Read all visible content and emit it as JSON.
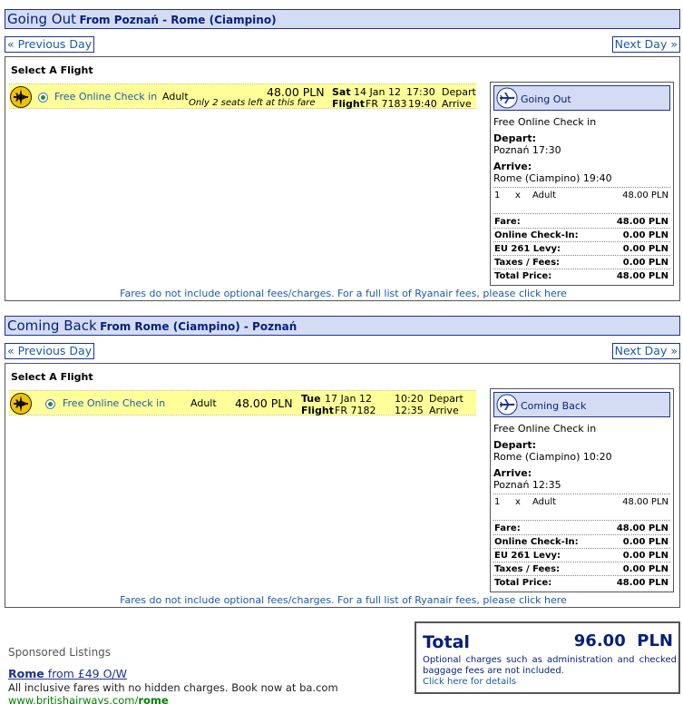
{
  "outbound": {
    "heading": "Going Out",
    "route": "From Poznań - Rome (Ciampino)",
    "prev_label": "« Previous Day",
    "next_label": "Next Day »",
    "select_title": "Select A Flight",
    "flight": {
      "checkin": "Free Online Check in",
      "pax_type": "Adult",
      "price": "48.00 PLN",
      "seats_note": "Only 2 seats left at this fare",
      "day": "Sat",
      "date": "14 Jan 12",
      "flight_label": "Flight",
      "flight_no": "FR 7183",
      "depart_time": "17:30",
      "depart_label": "Depart",
      "arrive_time": "19:40",
      "arrive_label": "Arrive"
    },
    "summary": {
      "title": "Going Out",
      "checkin": "Free Online Check in",
      "depart_label": "Depart:",
      "depart_value": "Poznań 17:30",
      "arrive_label": "Arrive:",
      "arrive_value": "Rome (Ciampino) 19:40",
      "pax_count": "1",
      "pax_x": "x",
      "pax_type": "Adult",
      "pax_price": "48.00 PLN",
      "rows": [
        {
          "label": "Fare:",
          "value": "48.00 PLN"
        },
        {
          "label": "Online Check-In:",
          "value": "0.00 PLN"
        },
        {
          "label": "EU 261 Levy:",
          "value": "0.00 PLN"
        },
        {
          "label": "Taxes / Fees:",
          "value": "0.00 PLN"
        },
        {
          "label": "Total Price:",
          "value": "48.00 PLN"
        }
      ]
    },
    "fare_note": "Fares do not include optional fees/charges. For a full list of Ryanair fees, please click here"
  },
  "return": {
    "heading": "Coming Back",
    "route": "From Rome (Ciampino) - Poznań",
    "prev_label": "« Previous Day",
    "next_label": "Next Day »",
    "select_title": "Select A Flight",
    "flight": {
      "checkin": "Free Online Check in",
      "pax_type": "Adult",
      "price": "48.00 PLN",
      "day": "Tue",
      "date": "17 Jan 12",
      "flight_label": "Flight",
      "flight_no": "FR 7182",
      "depart_time": "10:20",
      "depart_label": "Depart",
      "arrive_time": "12:35",
      "arrive_label": "Arrive"
    },
    "summary": {
      "title": "Coming Back",
      "checkin": "Free Online Check in",
      "depart_label": "Depart:",
      "depart_value": "Rome (Ciampino) 10:20",
      "arrive_label": "Arrive:",
      "arrive_value": "Poznań 12:35",
      "pax_count": "1",
      "pax_x": "x",
      "pax_type": "Adult",
      "pax_price": "48.00 PLN",
      "rows": [
        {
          "label": "Fare:",
          "value": "48.00 PLN"
        },
        {
          "label": "Online Check-In:",
          "value": "0.00 PLN"
        },
        {
          "label": "EU 261 Levy:",
          "value": "0.00 PLN"
        },
        {
          "label": "Taxes / Fees:",
          "value": "0.00 PLN"
        },
        {
          "label": "Total Price:",
          "value": "48.00 PLN"
        }
      ]
    },
    "fare_note": "Fares do not include optional fees/charges. For a full list of Ryanair fees, please click here"
  },
  "sponsored": {
    "heading": "Sponsored Listings",
    "ad_title_bold": "Rome",
    "ad_title_rest": "from £49 O/W",
    "ad_desc": "All inclusive fares with no hidden charges. Book now at ba.com",
    "ad_url_pre": "www.britishairways.com/",
    "ad_url_bold": "rome"
  },
  "total": {
    "label": "Total",
    "value": "96.00",
    "currency": "PLN",
    "note": "Optional charges such as administration and checked baggage fees are not included.",
    "link": "Click here for details"
  },
  "colors": {
    "header_bg": "#d4dcf4",
    "header_border": "#1c3294",
    "navy_text": "#061f7c",
    "link": "#1b5baa",
    "flight_row_bg": "#ffff99",
    "url_green": "#008000"
  },
  "icons": {
    "plane": "plane-icon",
    "radio": "radio-selected-icon"
  }
}
